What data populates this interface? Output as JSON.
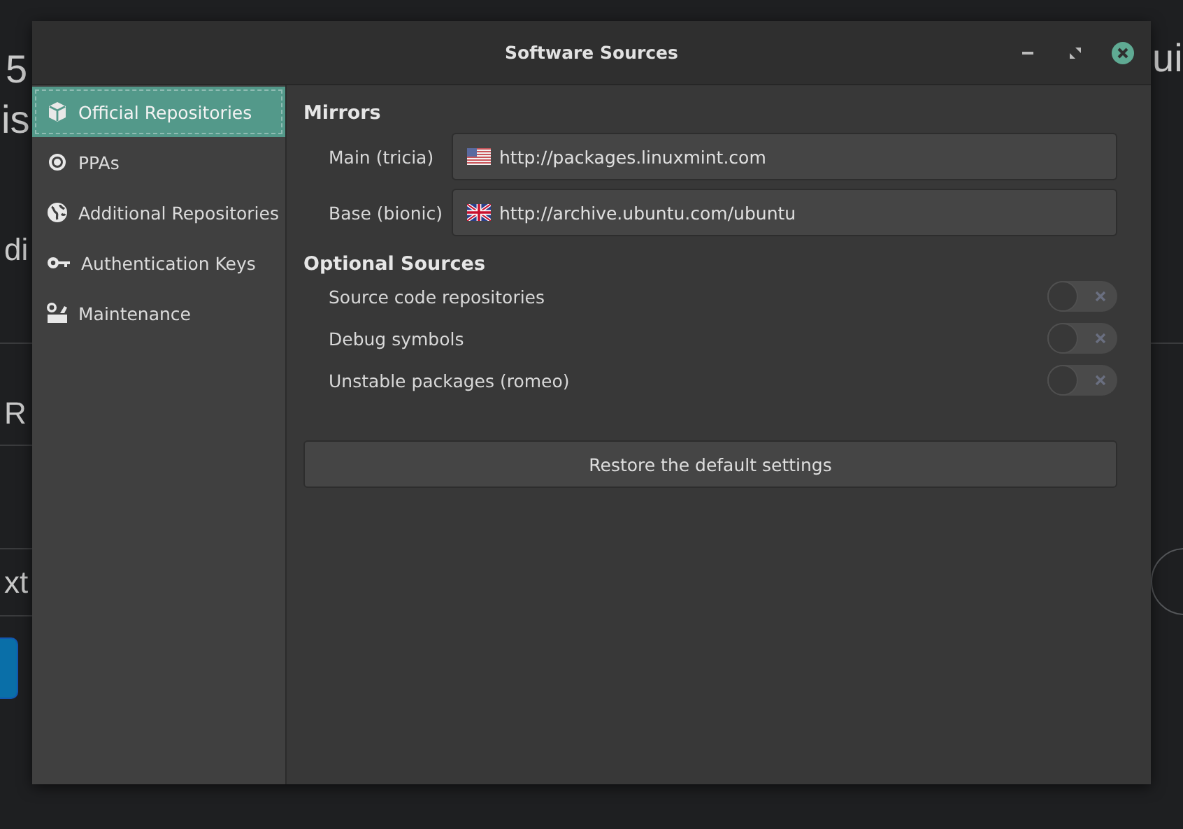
{
  "background": {
    "fragments": [
      {
        "text": "5"
      },
      {
        "text": "is"
      },
      {
        "text": "di"
      },
      {
        "text": "R"
      },
      {
        "text": "xt"
      },
      {
        "text": "ui"
      }
    ]
  },
  "window": {
    "title": "Software Sources"
  },
  "sidebar": {
    "items": [
      {
        "label": "Official Repositories",
        "selected": true
      },
      {
        "label": "PPAs",
        "selected": false
      },
      {
        "label": "Additional Repositories",
        "selected": false
      },
      {
        "label": "Authentication Keys",
        "selected": false
      },
      {
        "label": "Maintenance",
        "selected": false
      }
    ]
  },
  "mirrors": {
    "heading": "Mirrors",
    "rows": [
      {
        "label": "Main (tricia)",
        "value": "http://packages.linuxmint.com"
      },
      {
        "label": "Base (bionic)",
        "value": "http://archive.ubuntu.com/ubuntu"
      }
    ]
  },
  "optional_sources": {
    "heading": "Optional Sources",
    "items": [
      {
        "label": "Source code repositories",
        "on": false
      },
      {
        "label": "Debug symbols",
        "on": false
      },
      {
        "label": "Unstable packages (romeo)",
        "on": false
      }
    ]
  },
  "restore_button": "Restore the default settings"
}
